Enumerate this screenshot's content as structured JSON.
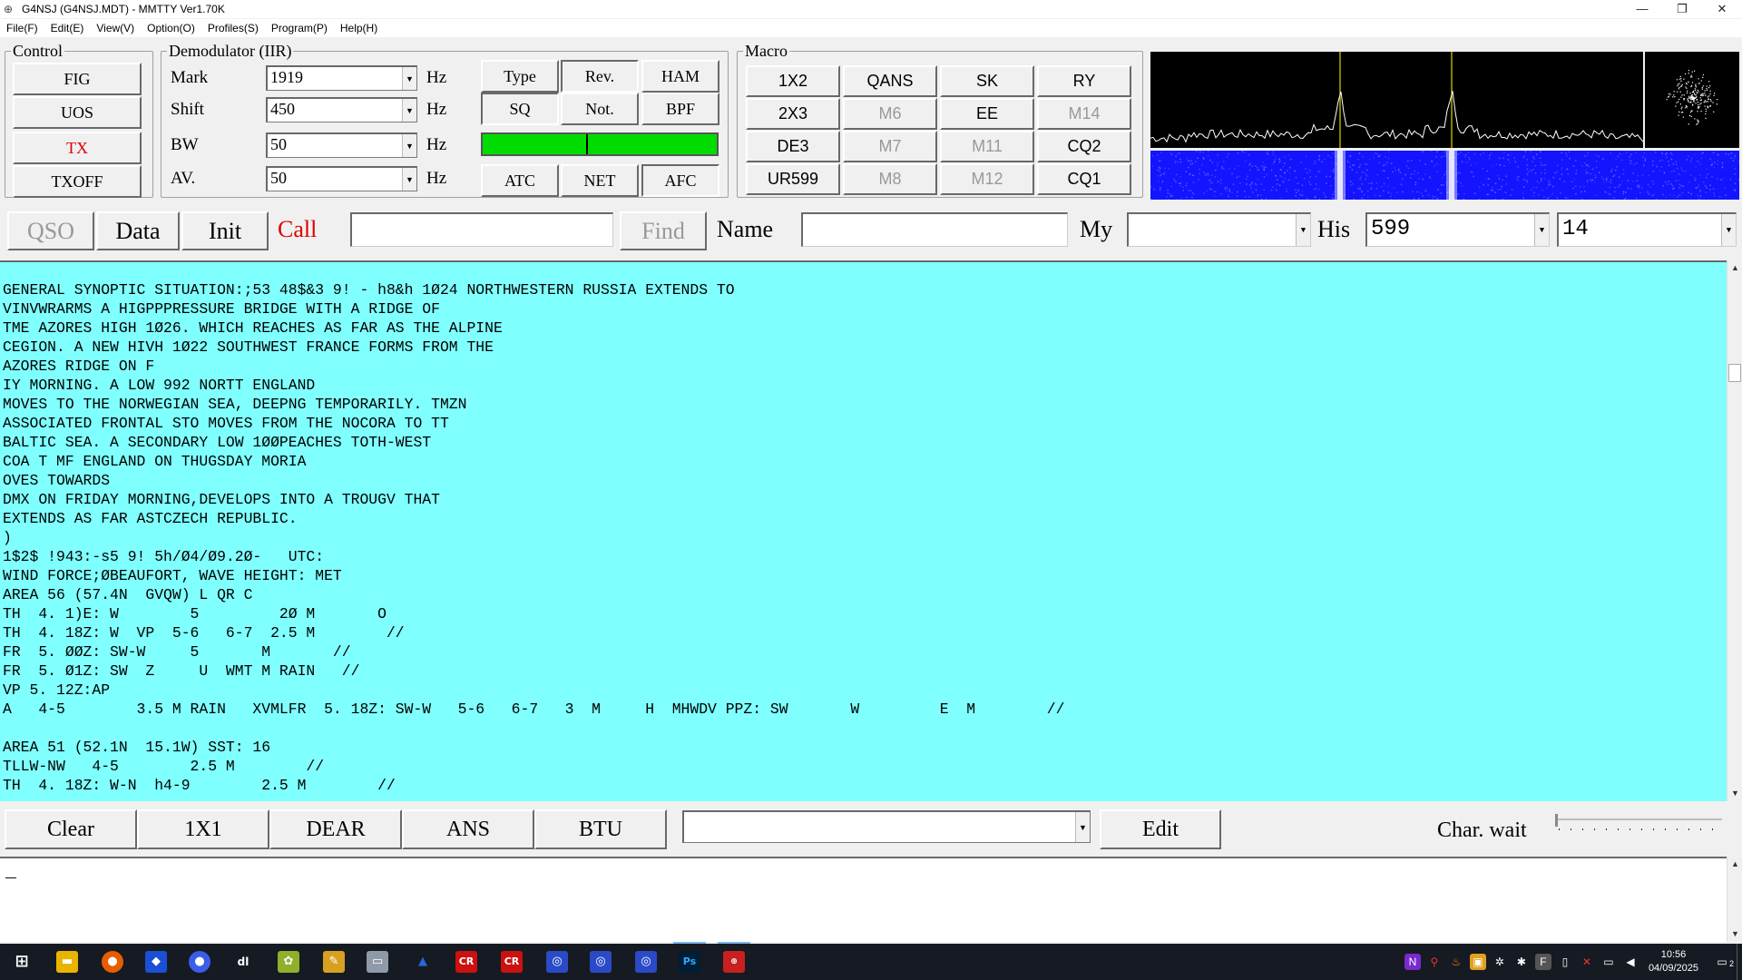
{
  "window": {
    "title": "G4NSJ (G4NSJ.MDT) - MMTTY Ver1.70K",
    "controls": [
      "—",
      "❐",
      "✕"
    ]
  },
  "menu": [
    "File(F)",
    "Edit(E)",
    "View(V)",
    "Option(O)",
    "Profiles(S)",
    "Program(P)",
    "Help(H)"
  ],
  "control": {
    "title": "Control",
    "buttons": [
      "FIG",
      "UOS",
      "TX",
      "TXOFF"
    ]
  },
  "demod": {
    "title": "Demodulator (IIR)",
    "mark_label": "Mark",
    "mark_value": "1919",
    "shift_label": "Shift",
    "shift_value": "450",
    "bw_label": "BW",
    "bw_value": "50",
    "av_label": "AV.",
    "av_value": "50",
    "unit": "Hz",
    "btn_type": "Type",
    "btn_rev": "Rev.",
    "btn_ham": "HAM",
    "btn_sq": "SQ",
    "btn_not": "Not.",
    "btn_bpf": "BPF",
    "btn_atc": "ATC",
    "btn_net": "NET",
    "btn_afc": "AFC",
    "tuning_level": 1.0
  },
  "macro": {
    "title": "Macro",
    "buttons": [
      "1X2",
      "QANS",
      "SK",
      "RY",
      "2X3",
      "M6",
      "EE",
      "M14",
      "DE3",
      "M7",
      "M11",
      "CQ2",
      "UR599",
      "M8",
      "M12",
      "CQ1"
    ]
  },
  "qso": {
    "qso": "QSO",
    "data": "Data",
    "init": "Init",
    "call": "Call",
    "call_value": "",
    "find": "Find",
    "name": "Name",
    "name_value": "",
    "my": "My",
    "my_value": "",
    "his": "His",
    "his_value": "599",
    "band_value": "14"
  },
  "rx_lines": [
    "GENERAL SYNOPTIC SITUATION:;53 48$&3 9! - h8&h 1Ø24 NORTHWESTERN RUSSIA EXTENDS TO",
    "VINVWRARMS A HIGPPPRESSURE BRIDGE WITH A RIDGE OF",
    "TME AZORES HIGH 1Ø26. WHICH REACHES AS FAR AS THE ALPINE",
    "CEGION. A NEW HIVH 1Ø22 SOUTHWEST FRANCE FORMS FROM THE",
    "AZORES RIDGE ON F",
    "IY MORNING. A LOW 992 NORTT ENGLAND",
    "MOVES TO THE NORWEGIAN SEA, DEEPNG TEMPORARILY. TMZN",
    "ASSOCIATED FRONTAL STO MOVES FROM THE NOCORA TO TT",
    "BALTIC SEA. A SECONDARY LOW 1ØØPEACHES TOTH-WEST",
    "COA T MF ENGLAND ON THUGSDAY MORIA",
    "OVES TOWARDS",
    "DMX ON FRIDAY MORNING,DEVELOPS INTO A TROUGV THAT",
    "EXTENDS AS FAR ASTCZECH REPUBLIC.",
    ")",
    "1$2$ !943:-s5 9! 5h/Ø4/Ø9.2Ø-   UTC:",
    "WIND FORCE;ØBEAUFORT, WAVE HEIGHT: MET",
    "AREA 56 (57.4N  GVQW) L QR C",
    "TH  4. 1)E: W        5         2Ø M       O",
    "TH  4. 18Z: W  VP  5-6   6-7  2.5 M        //",
    "FR  5. ØØZ: SW-W     5       M       //",
    "FR  5. Ø1Z: SW  Z     U  WMT M RAIN   //",
    "VP 5. 12Z:AP",
    "A   4-5        3.5 M RAIN   XVMLFR  5. 18Z: SW-W   5-6   6-7   3  M     H  MHWDV PPZ: SW       W         E  M        //",
    "",
    "AREA 51 (52.1N  15.1W) SST: 16",
    "TLLW-NW   4-5        2.5 M        //",
    "TH  4. 18Z: W-N  h4-9        2.5 M        //"
  ],
  "bottom": {
    "clear": "Clear",
    "b1x1": "1X1",
    "dear": "DEAR",
    "ans": "ANS",
    "btu": "BTU",
    "combo_value": "",
    "edit": "Edit",
    "charwait": "Char. wait"
  },
  "tx_text": "_",
  "taskbar": {
    "time": "10:56",
    "date": "04/09/2025",
    "notify_count": "2"
  }
}
